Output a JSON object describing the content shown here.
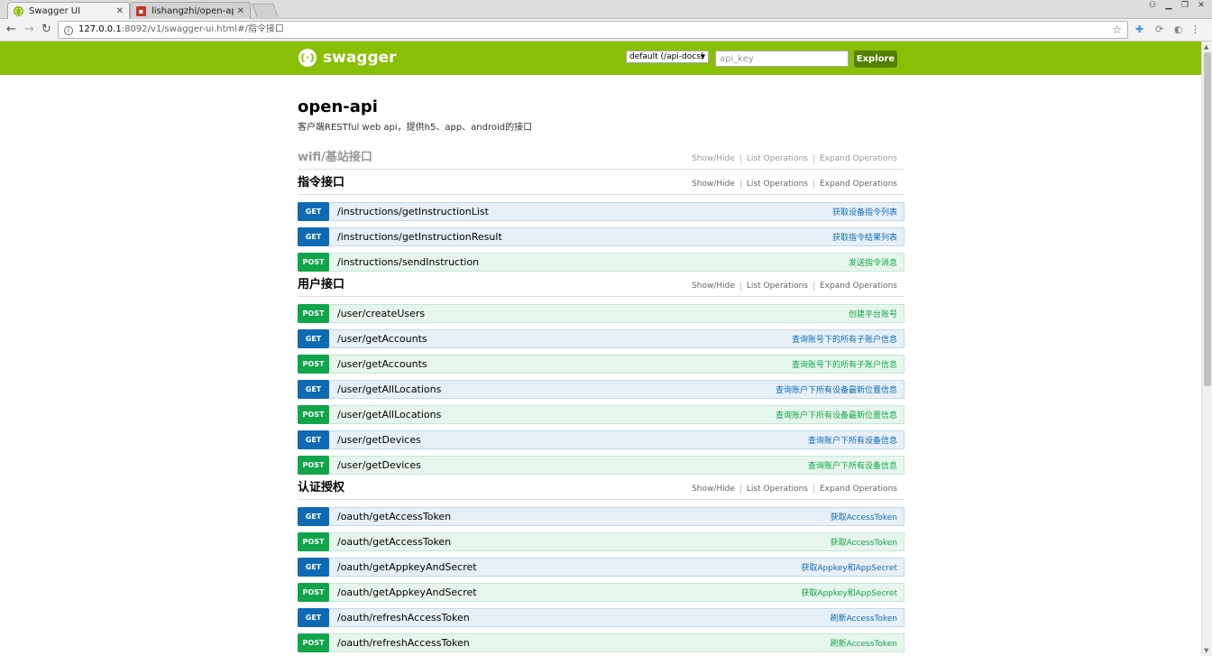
{
  "browser": {
    "tabs": [
      {
        "title": "Swagger UI",
        "active": true
      },
      {
        "title": "lishangzhi/open-api - …",
        "active": false
      }
    ],
    "url_host": "127.0.0.1",
    "url_path": ":8092/v1/swagger-ui.html#/指令接口"
  },
  "header": {
    "logo_text": "swagger",
    "docs_select": "default (/api-docs)",
    "api_key_placeholder": "api_key",
    "explore_label": "Explore"
  },
  "info": {
    "title": "open-api",
    "description": "客户端RESTful web api，提供h5、app、android的接口"
  },
  "links": {
    "show_hide": "Show/Hide",
    "list_operations": "List Operations",
    "expand_operations": "Expand Operations"
  },
  "resources": [
    {
      "name": "wifi/基站接口",
      "muted": true,
      "operations": []
    },
    {
      "name": "指令接口",
      "muted": false,
      "operations": [
        {
          "method": "GET",
          "path": "/instructions/getInstructionList",
          "summary": "获取设备指令列表"
        },
        {
          "method": "GET",
          "path": "/instructions/getInstructionResult",
          "summary": "获取指令结果列表"
        },
        {
          "method": "POST",
          "path": "/instructions/sendInstruction",
          "summary": "发送指令消息"
        }
      ]
    },
    {
      "name": "用户接口",
      "muted": false,
      "operations": [
        {
          "method": "POST",
          "path": "/user/createUsers",
          "summary": "创建平台账号"
        },
        {
          "method": "GET",
          "path": "/user/getAccounts",
          "summary": "查询账号下的所有子账户信息"
        },
        {
          "method": "POST",
          "path": "/user/getAccounts",
          "summary": "查询账号下的所有子账户信息"
        },
        {
          "method": "GET",
          "path": "/user/getAllLocations",
          "summary": "查询账户下所有设备最新位置信息"
        },
        {
          "method": "POST",
          "path": "/user/getAllLocations",
          "summary": "查询账户下所有设备最新位置信息"
        },
        {
          "method": "GET",
          "path": "/user/getDevices",
          "summary": "查询账户下所有设备信息"
        },
        {
          "method": "POST",
          "path": "/user/getDevices",
          "summary": "查询账户下所有设备信息"
        }
      ]
    },
    {
      "name": "认证授权",
      "muted": false,
      "operations": [
        {
          "method": "GET",
          "path": "/oauth/getAccessToken",
          "summary": "获取AccessToken"
        },
        {
          "method": "POST",
          "path": "/oauth/getAccessToken",
          "summary": "获取AccessToken"
        },
        {
          "method": "GET",
          "path": "/oauth/getAppkeyAndSecret",
          "summary": "获取Appkey和AppSecret"
        },
        {
          "method": "POST",
          "path": "/oauth/getAppkeyAndSecret",
          "summary": "获取Appkey和AppSecret"
        },
        {
          "method": "GET",
          "path": "/oauth/refreshAccessToken",
          "summary": "刷新AccessToken"
        },
        {
          "method": "POST",
          "path": "/oauth/refreshAccessToken",
          "summary": "刷新AccessToken"
        }
      ]
    }
  ]
}
